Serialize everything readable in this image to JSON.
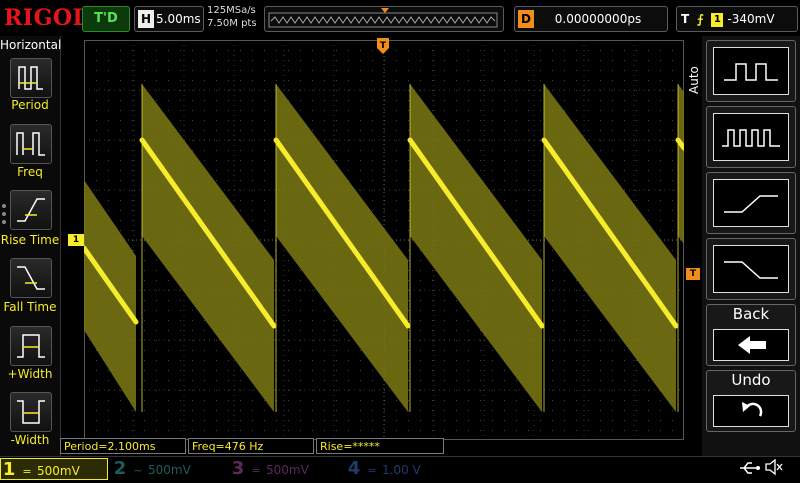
{
  "brand": "RIGOL",
  "top": {
    "trigger_status": "T'D",
    "horizontal_key": "H",
    "timebase": "5.00ms",
    "sample_rate": "125MSa/s",
    "memory_points": "7.50M pts",
    "delay_key": "D",
    "delay_value": "0.00000000ps",
    "trigger_key": "T",
    "trigger_source": "1",
    "trigger_level": "-340mV"
  },
  "left_menu": {
    "title": "Horizontal",
    "items": [
      {
        "label": "Period",
        "icon": "period-icon"
      },
      {
        "label": "Freq",
        "icon": "freq-icon"
      },
      {
        "label": "Rise Time",
        "icon": "rise-time-icon"
      },
      {
        "label": "Fall Time",
        "icon": "fall-time-icon"
      },
      {
        "label": "+Width",
        "icon": "positive-width-icon"
      },
      {
        "label": "-Width",
        "icon": "negative-width-icon"
      }
    ]
  },
  "markers": {
    "ch1": "1",
    "trigger_level": "T",
    "trigger_position": "T"
  },
  "measurements": {
    "period": "Period=2.100ms",
    "freq": "Freq=476 Hz",
    "rise": "Rise=*****"
  },
  "channels": [
    {
      "num": "1",
      "coupling": "=",
      "scale": "500mV",
      "active": true,
      "color": "#f6ec2a"
    },
    {
      "num": "2",
      "coupling": "~",
      "scale": "500mV",
      "active": false,
      "color": "#1f5d5d"
    },
    {
      "num": "3",
      "coupling": "=",
      "scale": "500mV",
      "active": false,
      "color": "#5a2a5a"
    },
    {
      "num": "4",
      "coupling": "=",
      "scale": "1.00 V",
      "active": false,
      "color": "#203a6a"
    }
  ],
  "right_menu": {
    "title": "Auto",
    "back_label": "Back",
    "undo_label": "Undo"
  },
  "colors": {
    "trace": "#f6ec2a",
    "trace_band": "#8a8a1a",
    "trigger": "#f28c1a",
    "brand": "#e8141c"
  }
}
